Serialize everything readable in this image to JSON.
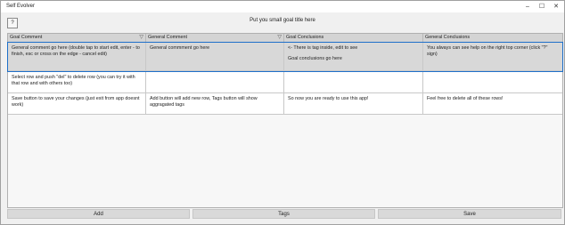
{
  "window": {
    "title": "Self Evolver"
  },
  "titlebar": {
    "minimize": "–",
    "maximize": "☐",
    "close": "✕"
  },
  "help_button": {
    "label": "?"
  },
  "goal_title": "Put you small goal title here",
  "grid": {
    "columns": [
      "Goal Comment",
      "General Comment",
      "Goal Conclusions",
      "General Conclusions"
    ],
    "rows": [
      {
        "goal_comment": "General comment go here (double tap to start edit, enter - to finish, esc or cross on the edge - cancel edit)",
        "general_comment": "General commment go here",
        "goal_conclusions_line1": "<- There is tag inside, edit to see",
        "goal_conclusions_line2": "Goal conclusions go here",
        "general_conclusions": "You always can see help on the right top corner (click \"?\" sign)"
      },
      {
        "goal_comment": "Select row and push \"del\" to delete row (you can try it with that row and with others too)",
        "general_comment": "",
        "goal_conclusions_line1": "",
        "goal_conclusions_line2": "",
        "general_conclusions": ""
      },
      {
        "goal_comment": "Save button to save your changes (just exit from app doesnt work)",
        "general_comment": "Add button will add new row, Tags button will show aggragated tags",
        "goal_conclusions_line1": "So now you are ready to use this app!",
        "goal_conclusions_line2": "",
        "general_conclusions": "Feel free to delete all of these rows!"
      }
    ]
  },
  "buttons": {
    "add": "Add",
    "tags": "Tags",
    "save": "Save"
  }
}
